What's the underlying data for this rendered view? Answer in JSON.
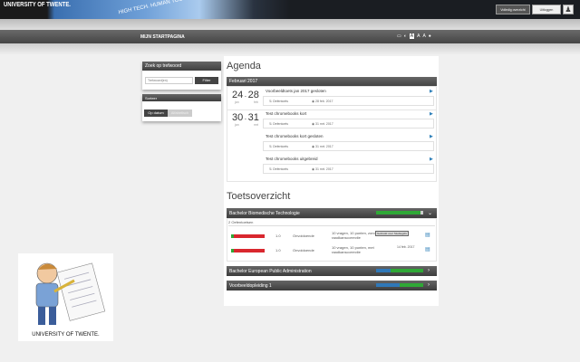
{
  "header": {
    "logo": "UNIVERSITY OF TWENTE.",
    "slogan": "HIGH TECH. HUMAN TOUCH",
    "btn_overview": "Volledig overzicht",
    "btn_logout": "Uitloggen"
  },
  "nav": {
    "title": "MIJN STARTPAGINA",
    "icons": [
      "monitor-icon",
      "contrast-icon",
      "font-small-icon",
      "font-medium-icon",
      "font-large-icon",
      "globe-icon"
    ]
  },
  "sidebar": {
    "search_title": "Zoek op trefwoord",
    "search_placeholder": "Trefwoord(en)",
    "filter": "Filter",
    "sort_title": "Sorteer",
    "sort_date": "Op datum",
    "sort_alpha": "Alfabetisch"
  },
  "agenda": {
    "title": "Agenda",
    "month": "Februari 2017",
    "groups": [
      {
        "from": "24",
        "to": "28",
        "from_m": "jan",
        "to_m": "feb"
      },
      {
        "from": "30",
        "to": "31",
        "from_m": "jan",
        "to_m": "mrt"
      }
    ],
    "events": [
      {
        "title": "Voorbeeldtoets jan 2017 gesloten",
        "type": "Oefentoets",
        "date": "28 feb. 2017"
      },
      {
        "title": "Test chromebooks kort",
        "type": "Oefentoets",
        "date": "31 mrt. 2017"
      },
      {
        "title": "Test chromebooks kort gesloten",
        "type": "Oefentoets",
        "date": "31 mrt. 2017"
      },
      {
        "title": "Test chromebooks uitgebreid",
        "type": "Oefentoets",
        "date": "31 mrt. 2017"
      }
    ]
  },
  "tests": {
    "title": "Toetsoverzicht",
    "sections": [
      {
        "name": "Bachelor Biomedische Technologie",
        "progress_blue": 0,
        "progress_green": 0.95
      },
      {
        "name": "Bachelor European Public Administration",
        "progress_blue": 0.3,
        "progress_green": 0.7
      },
      {
        "name": "Voorbeeldopleiding 1",
        "progress_blue": 0.5,
        "progress_green": 0.5
      }
    ],
    "count_label": "2 Oefentoetsen",
    "rows": [
      {
        "grade": "1.0",
        "result": "Onvoldoende",
        "desc": "10 vragen, 10 punten, zonder raadkanscorrectie",
        "badge": "Gebruikt voor Studiegids",
        "date": ""
      },
      {
        "grade": "1.0",
        "result": "Onvoldoende",
        "desc": "10 vragen, 10 punten, met raadkanscorrectie",
        "badge": "",
        "date": "14 feb. 2017"
      }
    ]
  },
  "footer_logo": "UNIVERSITY OF TWENTE."
}
